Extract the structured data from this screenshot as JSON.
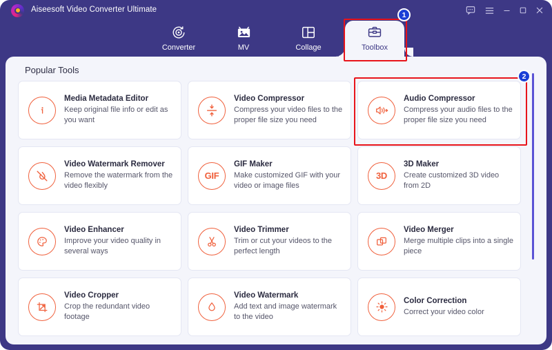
{
  "window": {
    "app_title": "Aiseesoft Video Converter Ultimate",
    "logo_icon": "aiseesoft-logo-icon",
    "controls": [
      {
        "name": "feedback-icon",
        "label": "Feedback"
      },
      {
        "name": "menu-icon",
        "label": "Menu"
      },
      {
        "name": "minimize-icon",
        "label": "Minimize"
      },
      {
        "name": "maximize-icon",
        "label": "Maximize"
      },
      {
        "name": "close-icon",
        "label": "Close"
      }
    ],
    "frame_color": "#3d3885",
    "panel_color": "#f4f5fb"
  },
  "nav": {
    "tabs": [
      {
        "label": "Converter",
        "icon": "converter-icon",
        "active": false
      },
      {
        "label": "MV",
        "icon": "mv-icon",
        "active": false
      },
      {
        "label": "Collage",
        "icon": "collage-icon",
        "active": false
      },
      {
        "label": "Toolbox",
        "icon": "toolbox-icon",
        "active": true
      }
    ]
  },
  "main": {
    "section_title": "Popular Tools",
    "accent_color": "#f0603c",
    "highlight_color": "#e8131a",
    "badge_color": "#1a3fd6",
    "tools": [
      {
        "title": "Media Metadata Editor",
        "desc": "Keep original file info or edit as you want",
        "icon": "info-circle-icon",
        "highlighted": false
      },
      {
        "title": "Video Compressor",
        "desc": "Compress your video files to the proper file size you need",
        "icon": "compress-arrows-icon",
        "highlighted": false
      },
      {
        "title": "Audio Compressor",
        "desc": "Compress your audio files to the proper file size you need",
        "icon": "speaker-compress-icon",
        "highlighted": true
      },
      {
        "title": "Video Watermark Remover",
        "desc": "Remove the watermark from the video flexibly",
        "icon": "watermark-remove-icon",
        "highlighted": false
      },
      {
        "title": "GIF Maker",
        "desc": "Make customized GIF with your video or image files",
        "icon": "gif-icon",
        "glyph": "GIF",
        "highlighted": false
      },
      {
        "title": "3D Maker",
        "desc": "Create customized 3D video from 2D",
        "icon": "three-d-icon",
        "glyph": "3D",
        "highlighted": false
      },
      {
        "title": "Video Enhancer",
        "desc": "Improve your video quality in several ways",
        "icon": "palette-icon",
        "highlighted": false
      },
      {
        "title": "Video Trimmer",
        "desc": "Trim or cut your videos to the perfect length",
        "icon": "scissors-icon",
        "highlighted": false
      },
      {
        "title": "Video Merger",
        "desc": "Merge multiple clips into a single piece",
        "icon": "merge-layers-icon",
        "highlighted": false
      },
      {
        "title": "Video Cropper",
        "desc": "Crop the redundant video footage",
        "icon": "crop-icon",
        "highlighted": false
      },
      {
        "title": "Video Watermark",
        "desc": "Add text and image watermark to the video",
        "icon": "droplet-icon",
        "highlighted": false
      },
      {
        "title": "Color Correction",
        "desc": "Correct your video color",
        "icon": "brightness-sun-icon",
        "highlighted": false
      }
    ]
  },
  "annotations": {
    "badges": [
      {
        "id": "badge-1",
        "label": "1",
        "target": "Toolbox"
      },
      {
        "id": "badge-2",
        "label": "2",
        "target": "Audio Compressor"
      }
    ]
  },
  "scrollbar": {
    "orientation": "vertical",
    "thumb_color": "#5a52d5"
  }
}
